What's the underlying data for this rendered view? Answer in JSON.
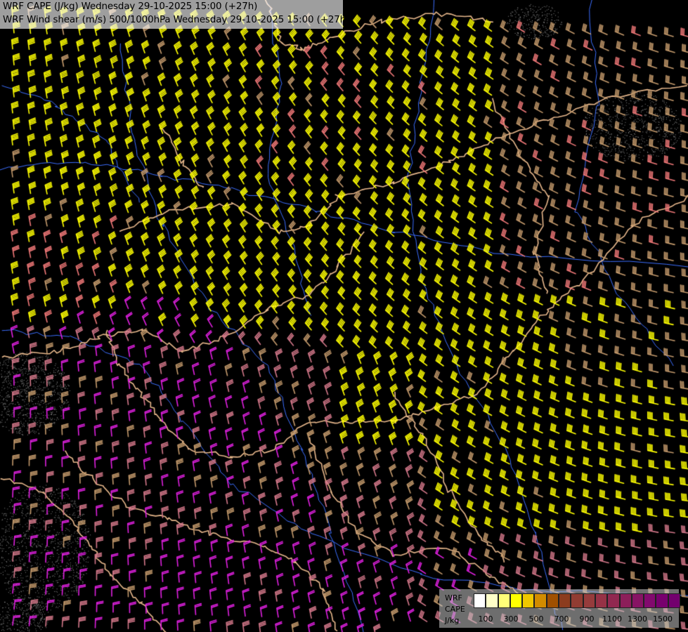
{
  "header": {
    "line1": "WRF CAPE (J/kg) Wednesday 29-10-2025 15:00 (+27h)",
    "line2": "WRF Wind shear (m/s) 500/1000hPa Wednesday 29-10-2025 15:00 (+27h)"
  },
  "legend": {
    "name1": "WRF",
    "name2": "CAPE",
    "name3": "J/kg",
    "colors": [
      "#ffffff",
      "#ffffc8",
      "#ffff78",
      "#ffff00",
      "#f0c800",
      "#d28c00",
      "#a05000",
      "#8c3c1e",
      "#913c32",
      "#963c3c",
      "#963246",
      "#912850",
      "#8c1e5a",
      "#871464",
      "#820a6e",
      "#78006e",
      "#73006e"
    ],
    "ticks": [
      "100",
      "300",
      "500",
      "700",
      "900",
      "1100",
      "1300",
      "1500"
    ]
  },
  "map": {
    "colors": {
      "background": "#000000",
      "borders": "#e8b88c",
      "rivers": "#3c6eff",
      "barb_yellow": "#ffff00",
      "barb_tan": "#c49a6c",
      "barb_pink": "#f07878",
      "barb_rose": "#d4788a",
      "barb_magenta": "#e020e0",
      "terrain_stipple": "#8a8a8a"
    },
    "wind_direction_deg": 225
  }
}
